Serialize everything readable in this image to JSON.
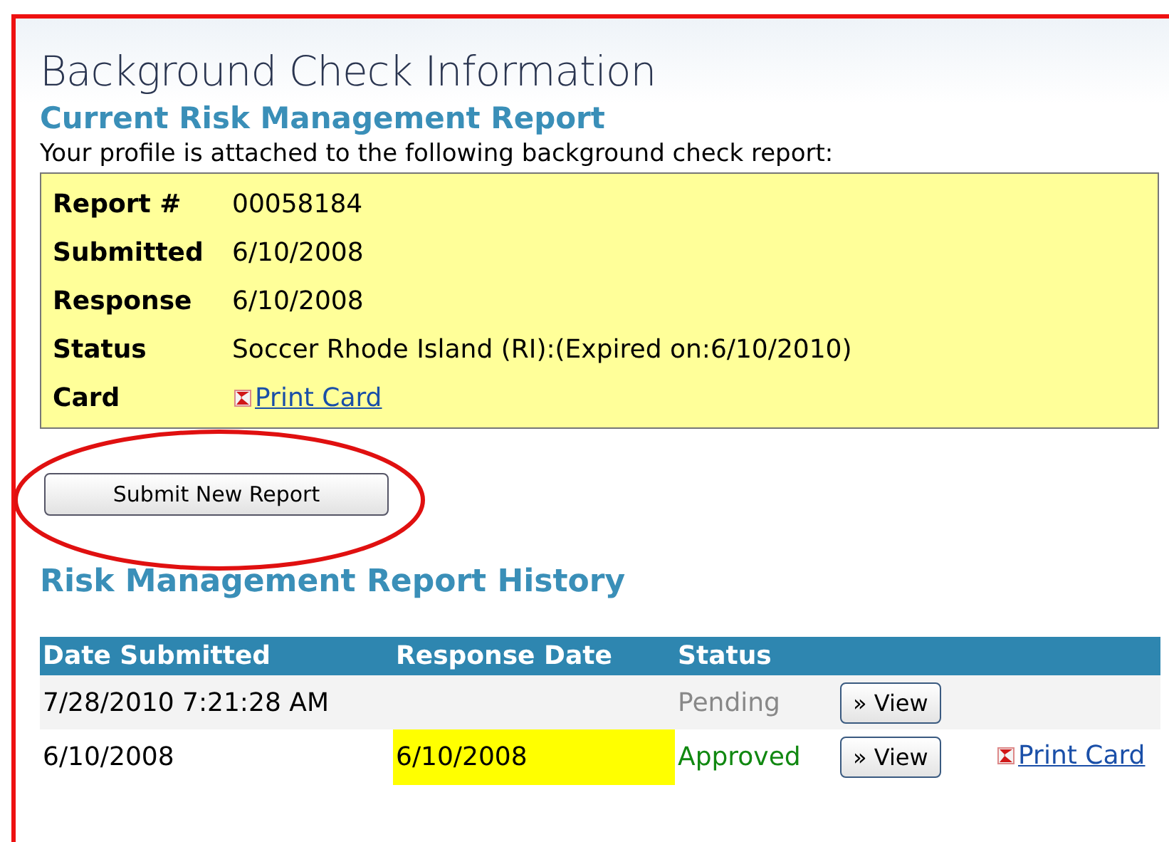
{
  "page_title": "Background Check Information",
  "current_report": {
    "heading": "Current Risk Management Report",
    "intro": "Your profile is attached to the following background check report:",
    "fields": [
      {
        "label": "Report #",
        "value": "00058184",
        "kind": "text"
      },
      {
        "label": "Submitted",
        "value": "6/10/2008",
        "kind": "text"
      },
      {
        "label": "Response",
        "value": "6/10/2008",
        "kind": "text"
      },
      {
        "label": "Status",
        "value": "Soccer Rhode Island (RI):(Expired on:6/10/2010)",
        "kind": "text"
      },
      {
        "label": "Card",
        "value": "Print Card",
        "kind": "link"
      }
    ]
  },
  "submit_button": "Submit New Report",
  "history": {
    "heading": "Risk Management Report History",
    "columns": [
      "Date Submitted",
      "Response Date",
      "Status"
    ],
    "rows": [
      {
        "date_submitted": "7/28/2010 7:21:28 AM",
        "status": "Pending",
        "kind": "pending",
        "view": "» View",
        "highlighted": false
      },
      {
        "date_submitted": "6/10/2008",
        "response_date": "6/10/2008",
        "status": "Approved",
        "kind": "approved",
        "view": "» View",
        "print_card": "Print Card",
        "highlighted": true
      }
    ]
  }
}
